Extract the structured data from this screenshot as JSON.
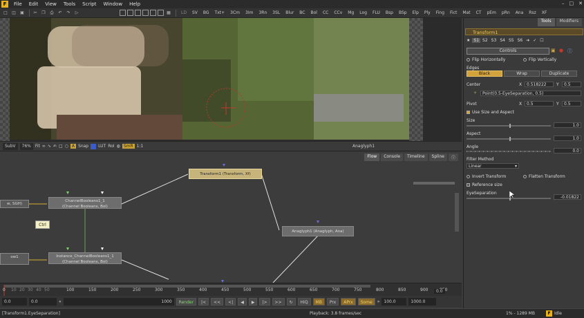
{
  "menu": {
    "items": [
      "File",
      "Edit",
      "View",
      "Tools",
      "Script",
      "Window",
      "Help"
    ],
    "logo": "F"
  },
  "toolbar": {
    "tools": [
      "LD",
      "SV",
      "BG",
      "Txt+",
      "3Cm",
      "3Im",
      "3Rn",
      "3SL",
      "Blur",
      "BC",
      "Bol",
      "CC",
      "CCv",
      "Mg",
      "Log",
      "FLU",
      "Bsp",
      "BSp",
      "Elp",
      "Ply",
      "Fing",
      "Fict",
      "Mat",
      "CT",
      "pEm",
      "pRn",
      "Ana",
      "Rsz",
      "XF"
    ]
  },
  "viewer": {
    "toolbar": {
      "subview": "SubV",
      "zoom": "76%",
      "fit": "Fit",
      "snap": "Snap",
      "lut": "LUT",
      "roi": "RoI",
      "smr": "SmR",
      "ratio": "1:1",
      "title": "Anaglyph1"
    }
  },
  "flow": {
    "tabs": [
      "Flow",
      "Console",
      "Timeline",
      "Spline"
    ],
    "nodes": {
      "left_top": "w, SGH)",
      "cb1_title": "ChannelBooleans1_1",
      "cb1_sub": "(Channel Booleans, Bol)",
      "xf_title": "Transform1 (Transform, Xf)",
      "ana_title": "Anaglyph1 (Anaglyph, Ana)",
      "left_bottom": "ow1",
      "inst_title": "Instance_ChannelBooleans1_1",
      "inst_sub": "(Channel Booleans, Bol)"
    },
    "tooltip": "Ctrl"
  },
  "timeline": {
    "ticks": [
      "0",
      "10",
      "20",
      "30",
      "40",
      "50",
      "100",
      "150",
      "200",
      "250",
      "300",
      "350",
      "400",
      "450",
      "500",
      "550",
      "600",
      "650",
      "700",
      "750",
      "800",
      "850",
      "900",
      "950"
    ],
    "current": "0.0"
  },
  "transport": {
    "start": "0.0",
    "start2": "0.0",
    "end": "1000",
    "render": "Render",
    "hiq": "HiQ",
    "mb": "MB",
    "prx": "Prx",
    "aprx": "APrx",
    "some": "Some",
    "range_start": "100.0",
    "range_end": "1000.0"
  },
  "status": {
    "left": "[Transform1.EyeSeparation]",
    "playback": "Playback: 3.8 frames/sec",
    "memory": "1% - 1289 MB",
    "state": "Idle"
  },
  "panel": {
    "tabs": [
      "Tools",
      "Modifiers"
    ],
    "title": "Transform1",
    "subtabs": [
      "S1",
      "S2",
      "S3",
      "S4",
      "S5",
      "S6"
    ],
    "controls_label": "Controls",
    "flip_h": "Flip Horizontally",
    "flip_v": "Flip Vertically",
    "edges": "Edges",
    "edge_buttons": [
      "Black",
      "Wrap",
      "Duplicate"
    ],
    "center": "Center",
    "center_x": "0.518222",
    "center_y": "0.5",
    "center_expr": "Point(0.5-EyeSeparation, 0.5)",
    "pivot": "Pivot",
    "pivot_x": "0.5",
    "pivot_y": "0.5",
    "use_size": "Use Size and Aspect",
    "size": "Size",
    "size_val": "1.0",
    "aspect": "Aspect",
    "aspect_val": "1.0",
    "angle": "Angle",
    "angle_val": "0.0",
    "filter_method": "Filter Method",
    "filter_value": "Linear",
    "invert": "Invert Transform",
    "flatten": "Flatten Transform",
    "ref_size": "Reference size",
    "eye_sep": "EyeSeparation",
    "eye_sep_val": "-0.01822",
    "x_label": "X",
    "y_label": "Y"
  }
}
